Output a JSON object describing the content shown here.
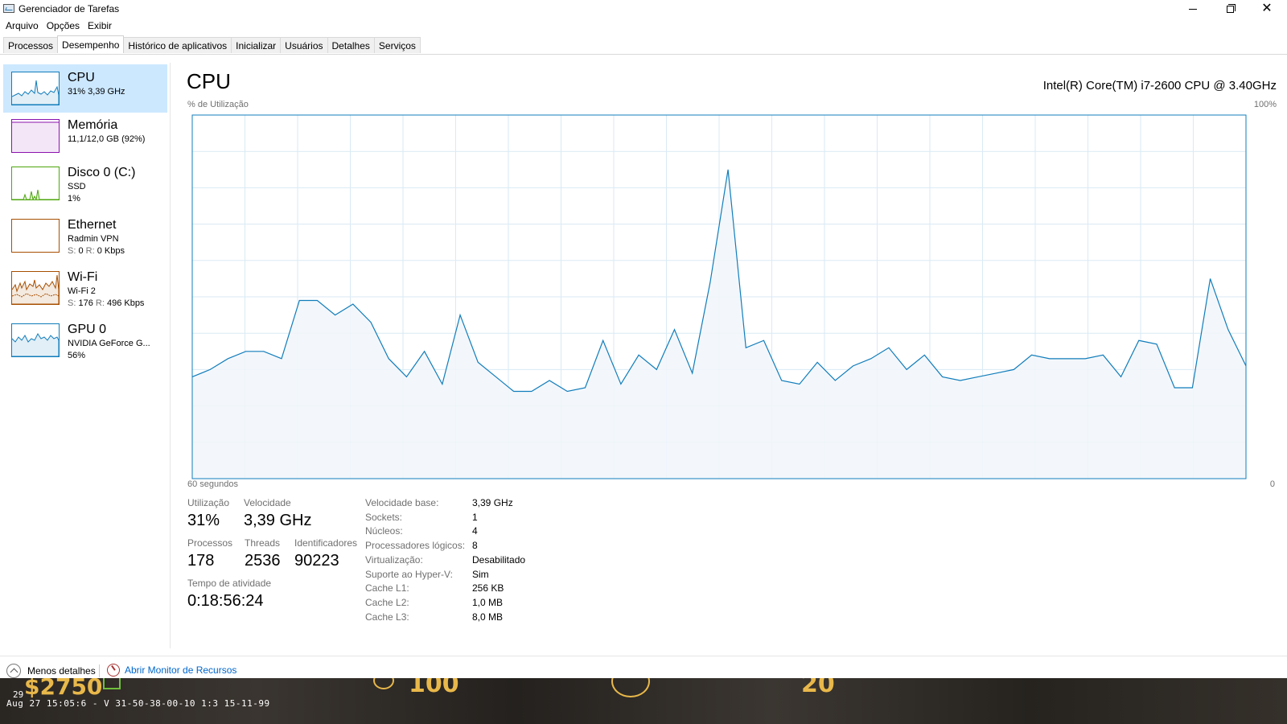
{
  "window": {
    "title": "Gerenciador de Tarefas"
  },
  "menu": [
    "Arquivo",
    "Opções",
    "Exibir"
  ],
  "tabs": [
    {
      "label": "Processos",
      "active": false
    },
    {
      "label": "Desempenho",
      "active": true
    },
    {
      "label": "Histórico de aplicativos",
      "active": false
    },
    {
      "label": "Inicializar",
      "active": false
    },
    {
      "label": "Usuários",
      "active": false
    },
    {
      "label": "Detalhes",
      "active": false
    },
    {
      "label": "Serviços",
      "active": false
    }
  ],
  "sidebar": {
    "items": [
      {
        "title": "CPU",
        "line1": "31% 3,39 GHz",
        "line2": "",
        "color": "#117dbb",
        "active": true
      },
      {
        "title": "Memória",
        "line1": "11,1/12,0 GB (92%)",
        "line2": "",
        "color": "#8b12ae",
        "active": false
      },
      {
        "title": "Disco 0 (C:)",
        "line1": "SSD",
        "line2": "1%",
        "color": "#4da60c",
        "active": false
      },
      {
        "title": "Ethernet",
        "line1": "Radmin VPN",
        "line2_s": "S:",
        "line2_sv": "0",
        "line2_r": "R:",
        "line2_rv": "0 Kbps",
        "color": "#a74f01",
        "active": false
      },
      {
        "title": "Wi-Fi",
        "line1": "Wi-Fi 2",
        "line2_s": "S:",
        "line2_sv": "176",
        "line2_r": "R:",
        "line2_rv": "496 Kbps",
        "color": "#a74f01",
        "active": false
      },
      {
        "title": "GPU 0",
        "line1": "NVIDIA GeForce G...",
        "line2": "56%",
        "color": "#117dbb",
        "active": false
      }
    ]
  },
  "main": {
    "title": "CPU",
    "model": "Intel(R) Core(TM) i7-2600 CPU @ 3.40GHz",
    "chart_top_left": "% de Utilização",
    "chart_top_right": "100%",
    "chart_bottom_left": "60 segundos",
    "chart_bottom_right": "0"
  },
  "chart_data": {
    "type": "area",
    "x_range_seconds": [
      60,
      0
    ],
    "ylim": [
      0,
      100
    ],
    "color": "#117dbb",
    "fill": "#f1f6fa",
    "values": [
      28,
      30,
      33,
      35,
      35,
      33,
      49,
      49,
      45,
      48,
      43,
      33,
      28,
      35,
      26,
      45,
      32,
      28,
      24,
      24,
      27,
      24,
      25,
      38,
      26,
      34,
      30,
      41,
      29,
      54,
      85,
      36,
      38,
      27,
      26,
      32,
      27,
      31,
      33,
      36,
      30,
      34,
      28,
      27,
      28,
      29,
      30,
      34,
      33,
      33,
      33,
      34,
      28,
      38,
      37,
      25,
      25,
      55,
      41,
      31
    ]
  },
  "stats": {
    "utilizacao_label": "Utilização",
    "utilizacao_value": "31%",
    "velocidade_label": "Velocidade",
    "velocidade_value": "3,39 GHz",
    "processos_label": "Processos",
    "processos_value": "178",
    "threads_label": "Threads",
    "threads_value": "2536",
    "ident_label": "Identificadores",
    "ident_value": "90223",
    "tempo_label": "Tempo de atividade",
    "tempo_value": "0:18:56:24"
  },
  "info": [
    {
      "key": "Velocidade base:",
      "value": "3,39 GHz"
    },
    {
      "key": "Sockets:",
      "value": "1"
    },
    {
      "key": "Núcleos:",
      "value": "4"
    },
    {
      "key": "Processadores lógicos:",
      "value": "8"
    },
    {
      "key": "Virtualização:",
      "value": "Desabilitado"
    },
    {
      "key": "Suporte ao Hyper-V:",
      "value": "Sim"
    },
    {
      "key": "Cache L1:",
      "value": "256 KB"
    },
    {
      "key": "Cache L2:",
      "value": "1,0 MB"
    },
    {
      "key": "Cache L3:",
      "value": "8,0 MB"
    }
  ],
  "footer": {
    "less_details": "Menos detalhes",
    "resource_monitor": "Abrir Monitor de Recursos"
  },
  "game_overlay": {
    "money": "$2750",
    "hp": "100",
    "ammo": "20",
    "small": "29",
    "status": "Aug 27 15:05:6 - V 31-50-38-00-10 1:3 15-11-99"
  }
}
